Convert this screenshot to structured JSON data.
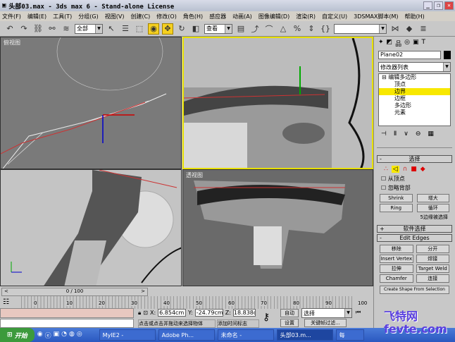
{
  "window": {
    "title": "头部03.max - 3ds max 6 - Stand-alone License",
    "min": "_",
    "max": "❐",
    "close": "✕"
  },
  "menu": [
    "文件(F)",
    "编辑(E)",
    "工具(T)",
    "分组(G)",
    "视图(V)",
    "创建(C)",
    "修改(O)",
    "角色(H)",
    "感应器",
    "动画(A)",
    "图像编辑(D)",
    "渲染(R)",
    "自定义(U)",
    "3DSMAX脚本(M)",
    "帮助(H)"
  ],
  "toolbar": {
    "selection_filter": "全部",
    "coord_system": "查看",
    "named_selection": ""
  },
  "viewports": {
    "top_left": "俯视图",
    "bottom_right": "透视图"
  },
  "command_panel": {
    "object_name": "Plane02",
    "object_color": "#000000",
    "modifier_list": "修改器列表",
    "stack": {
      "root": "编辑多边形",
      "items": [
        "顶点",
        "边界",
        "边框",
        "多边形",
        "元素"
      ],
      "selected": "边界"
    },
    "selection": {
      "title": "选择",
      "by_vertex": "从顶点",
      "ignore_backfacing": "忽略背部",
      "shrink": "Shrink",
      "grow": "增大",
      "ring": "Ring",
      "loop": "循环",
      "selected_count": "5边缘被选择"
    },
    "soft_selection": "软件选择",
    "edit_edges": {
      "title": "Edit Edges",
      "remove": "移除",
      "split": "分开",
      "insert_vertex": "Insert Vertex",
      "weld": "焊接",
      "extrude": "拉伸",
      "target_weld": "Target Weld",
      "chamfer": "Chamfer",
      "connect": "连接",
      "create_shape": "Create Shape From Selection"
    }
  },
  "timeline": {
    "frame": "0 / 100",
    "ticks": [
      "0",
      "10",
      "20",
      "30",
      "40",
      "50",
      "60",
      "70",
      "80",
      "90",
      "100"
    ],
    "progress": 0
  },
  "status": {
    "x": "6.854cm",
    "y": "-24.79cm",
    "z": "18.838cm",
    "auto_key": "自动",
    "set_key": "设置",
    "key_mode": "选择",
    "key_filters": "关键帧过滤...",
    "prompt": "点击或点击并拖动来选择物体",
    "add_time_tag": "添加时间标志"
  },
  "taskbar": {
    "start": "开始",
    "tasks": [
      "MyIE2 -",
      "Adobe Ph...",
      "未命名 -",
      "头部03.m...",
      "每"
    ]
  },
  "watermark": "飞特网 fevte.com"
}
